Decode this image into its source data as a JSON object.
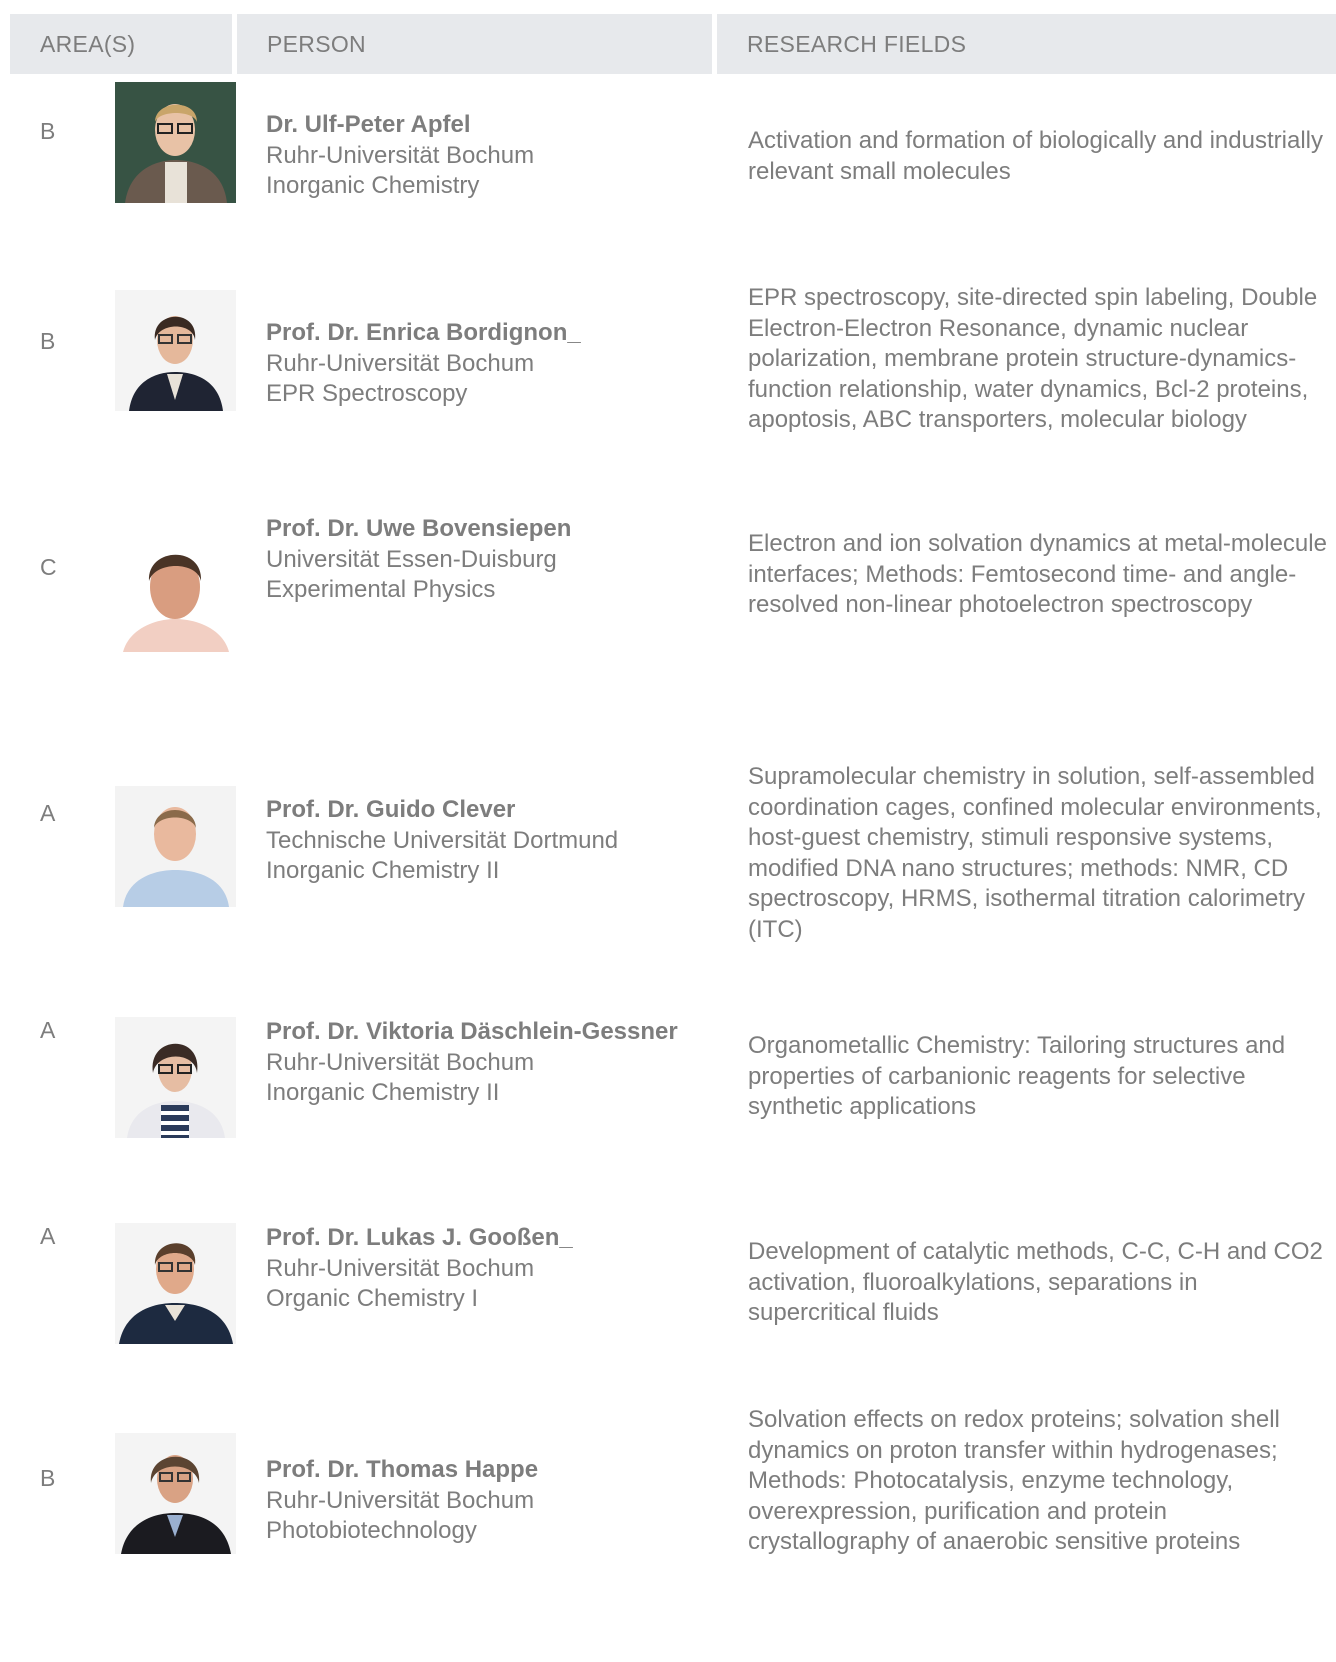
{
  "header": {
    "area": "AREA(S)",
    "person": "PERSON",
    "research": "RESEARCH FIELDS"
  },
  "rows": [
    {
      "area": "B",
      "name": "Dr. Ulf-Peter Apfel",
      "institution": "Ruhr-Universität Bochum",
      "department": "Inorganic Chemistry",
      "research": "Activation and formation of biologically and industrially relevant small molecules"
    },
    {
      "area": "B",
      "name": "Prof. Dr. Enrica Bordignon_",
      "institution": "Ruhr-Universität Bochum",
      "department": "EPR Spectroscopy",
      "research": "EPR spectroscopy, site-directed spin labeling, Double Electron-Electron Resonance, dynamic nuclear polarization, membrane protein structure-dynamics-function relationship, water dynamics, Bcl-2 proteins, apoptosis, ABC transporters, molecular biology"
    },
    {
      "area": "C",
      "name": "Prof. Dr. Uwe Bovensiepen",
      "institution": "Universität Essen-Duisburg",
      "department": "Experimental Physics",
      "research": "Electron and ion solvation dynamics at metal-molecule interfaces; Methods: Femtosecond time- and angle-resolved non-linear photoelectron spectroscopy"
    },
    {
      "area": "A",
      "name": "Prof. Dr. Guido Clever",
      "institution": "Technische Universität Dortmund",
      "department": "Inorganic Chemistry II",
      "research": "Supramolecular chemistry in solution, self-assembled coordination cages, confined molecular environments, host-guest chemistry, stimuli responsive systems, modified DNA nano structures; methods: NMR, CD spectroscopy, HRMS, isothermal titration calorimetry (ITC)"
    },
    {
      "area": "A",
      "name": "Prof. Dr. Viktoria Däschlein-Gessner",
      "institution": "Ruhr-Universität Bochum",
      "department": "Inorganic Chemistry II",
      "research": "Organometallic Chemistry: Tailoring structures and properties of carbanionic reagents for selective synthetic applications"
    },
    {
      "area": "A",
      "name": "Prof. Dr. Lukas J. Gooßen_",
      "institution": "Ruhr-Universität Bochum",
      "department": "Organic Chemistry I",
      "research": "Development of catalytic methods, C-C, C-H and CO2 activation, fluoroalkylations, separations in supercritical fluids"
    },
    {
      "area": "B",
      "name": "Prof. Dr. Thomas Happe",
      "institution": "Ruhr-Universität Bochum",
      "department": "Photobiotechnology",
      "research": "Solvation effects on redox proteins; solvation shell dynamics on proton transfer within hydrogenases; Methods: Photocatalysis, enzyme technology, overexpression, purification and protein crystallography of anaerobic sensitive proteins"
    }
  ],
  "colors": {
    "header_bg": "#e7e9ec",
    "text": "#7d7d7d"
  }
}
